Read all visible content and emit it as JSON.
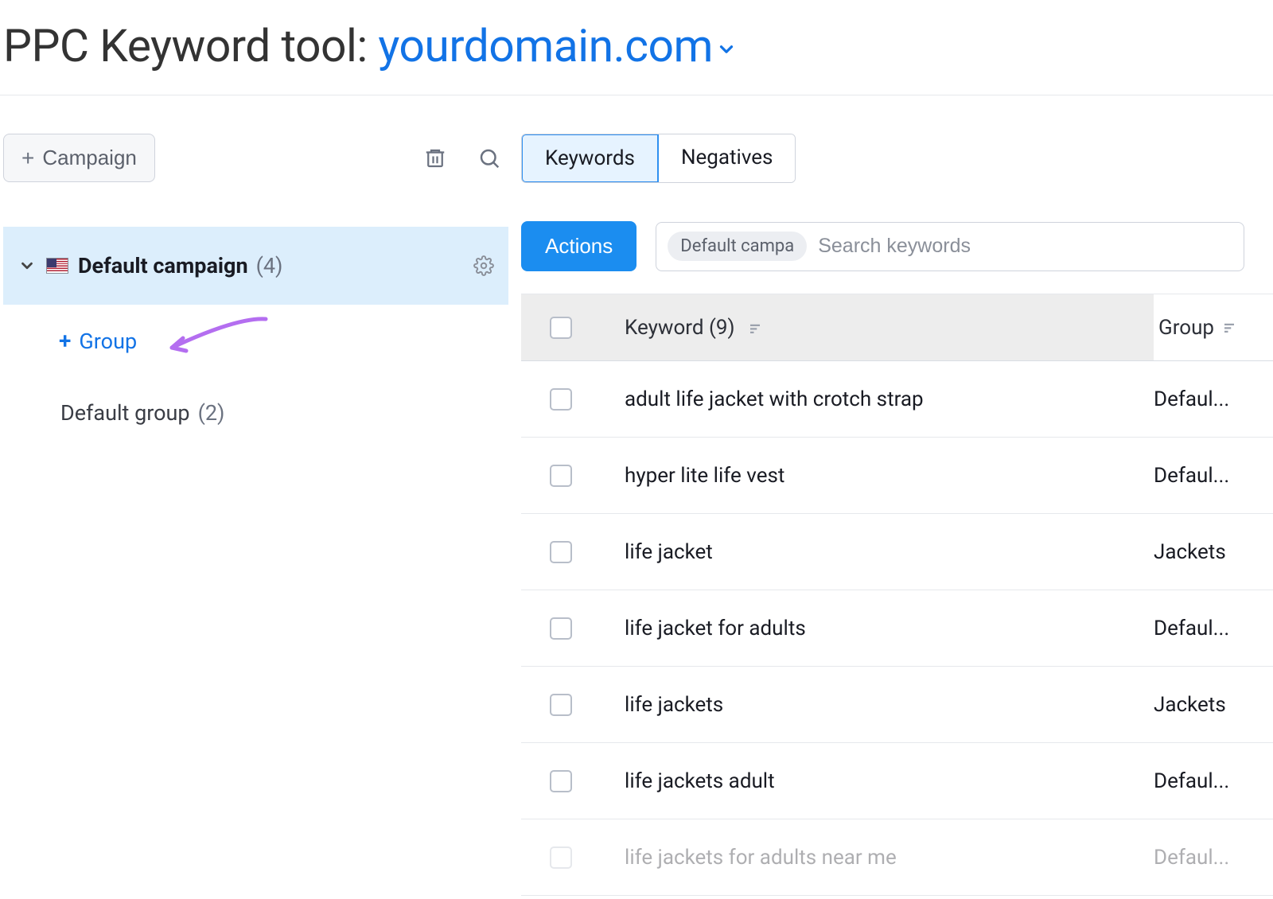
{
  "header": {
    "title_prefix": "PPC Keyword tool: ",
    "domain": "yourdomain.com"
  },
  "sidebar": {
    "campaign_button": "Campaign",
    "campaign": {
      "name": "Default campaign",
      "count_label": "(4)"
    },
    "add_group_label": "Group",
    "group": {
      "name": "Default group",
      "count_label": "(2)"
    }
  },
  "tabs": {
    "keywords": "Keywords",
    "negatives": "Negatives"
  },
  "toolbar": {
    "actions_label": "Actions",
    "chip": "Default campa",
    "search_placeholder": "Search keywords"
  },
  "table": {
    "header_keyword": "Keyword (9)",
    "header_group": "Group",
    "rows": [
      {
        "keyword": "adult life jacket with crotch strap",
        "group": "Defaul..."
      },
      {
        "keyword": "hyper lite life vest",
        "group": "Defaul..."
      },
      {
        "keyword": "life jacket",
        "group": "Jackets"
      },
      {
        "keyword": "life jacket for adults",
        "group": "Defaul..."
      },
      {
        "keyword": "life jackets",
        "group": "Jackets"
      },
      {
        "keyword": "life jackets adult",
        "group": "Defaul..."
      },
      {
        "keyword": "life jackets for adults near me",
        "group": "Defaul..."
      }
    ]
  }
}
